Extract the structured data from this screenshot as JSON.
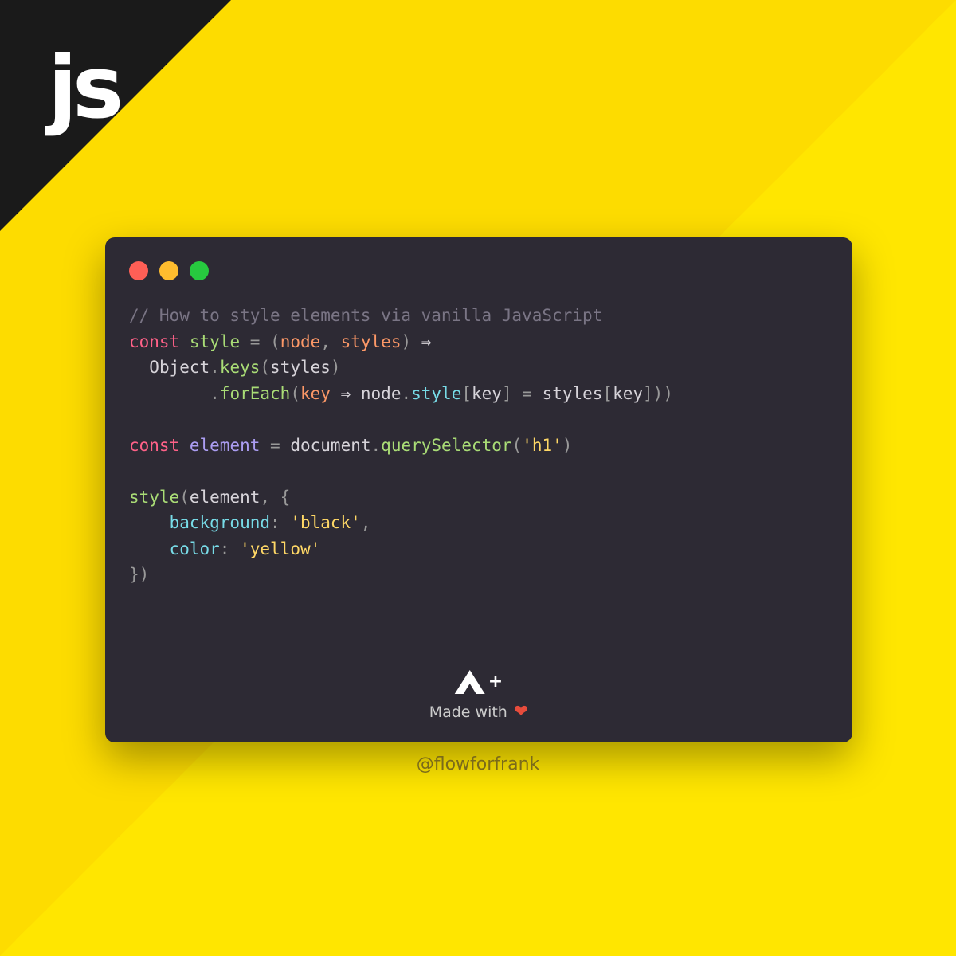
{
  "badge": {
    "label": "js"
  },
  "editor": {
    "colors": {
      "red": "#ff5f56",
      "yellow": "#ffbd2e",
      "green": "#27c93f"
    }
  },
  "code": {
    "comment": "// How to style elements via vanilla JavaScript",
    "l1": {
      "const": "const",
      "style": "style",
      "eq": "=",
      "open": "(",
      "node": "node",
      "comma": ",",
      "styles": "styles",
      "close": ")",
      "arrow": "⇒"
    },
    "l2": {
      "object": "Object",
      "dot1": ".",
      "keys": "keys",
      "open": "(",
      "styles": "styles",
      "close": ")"
    },
    "l3": {
      "dot": ".",
      "forEach": "forEach",
      "open": "(",
      "key": "key",
      "arrow": "⇒",
      "node": "node",
      "dot2": ".",
      "styleprop": "style",
      "br1": "[",
      "key2": "key",
      "br2": "]",
      "eq": "=",
      "styles": "styles",
      "br3": "[",
      "key3": "key",
      "br4": "]",
      ")": ")",
      ")2": ")"
    },
    "l4": {
      "const": "const",
      "element": "element",
      "eq": "=",
      "document": "document",
      "dot": ".",
      "qs": "querySelector",
      "open": "(",
      "str": "'h1'",
      "close": ")"
    },
    "l5": {
      "style": "style",
      "open": "(",
      "element": "element",
      "comma": ",",
      "brace": "{"
    },
    "l6": {
      "background": "background",
      "colon": ":",
      "val": "'black'",
      "comma": ","
    },
    "l7": {
      "color": "color",
      "colon": ":",
      "val": "'yellow'"
    },
    "l8": {
      "close": "})"
    }
  },
  "footer": {
    "madewith": "Made with",
    "heart": "❤",
    "handle": "@flowforfrank",
    "plus": "+"
  }
}
